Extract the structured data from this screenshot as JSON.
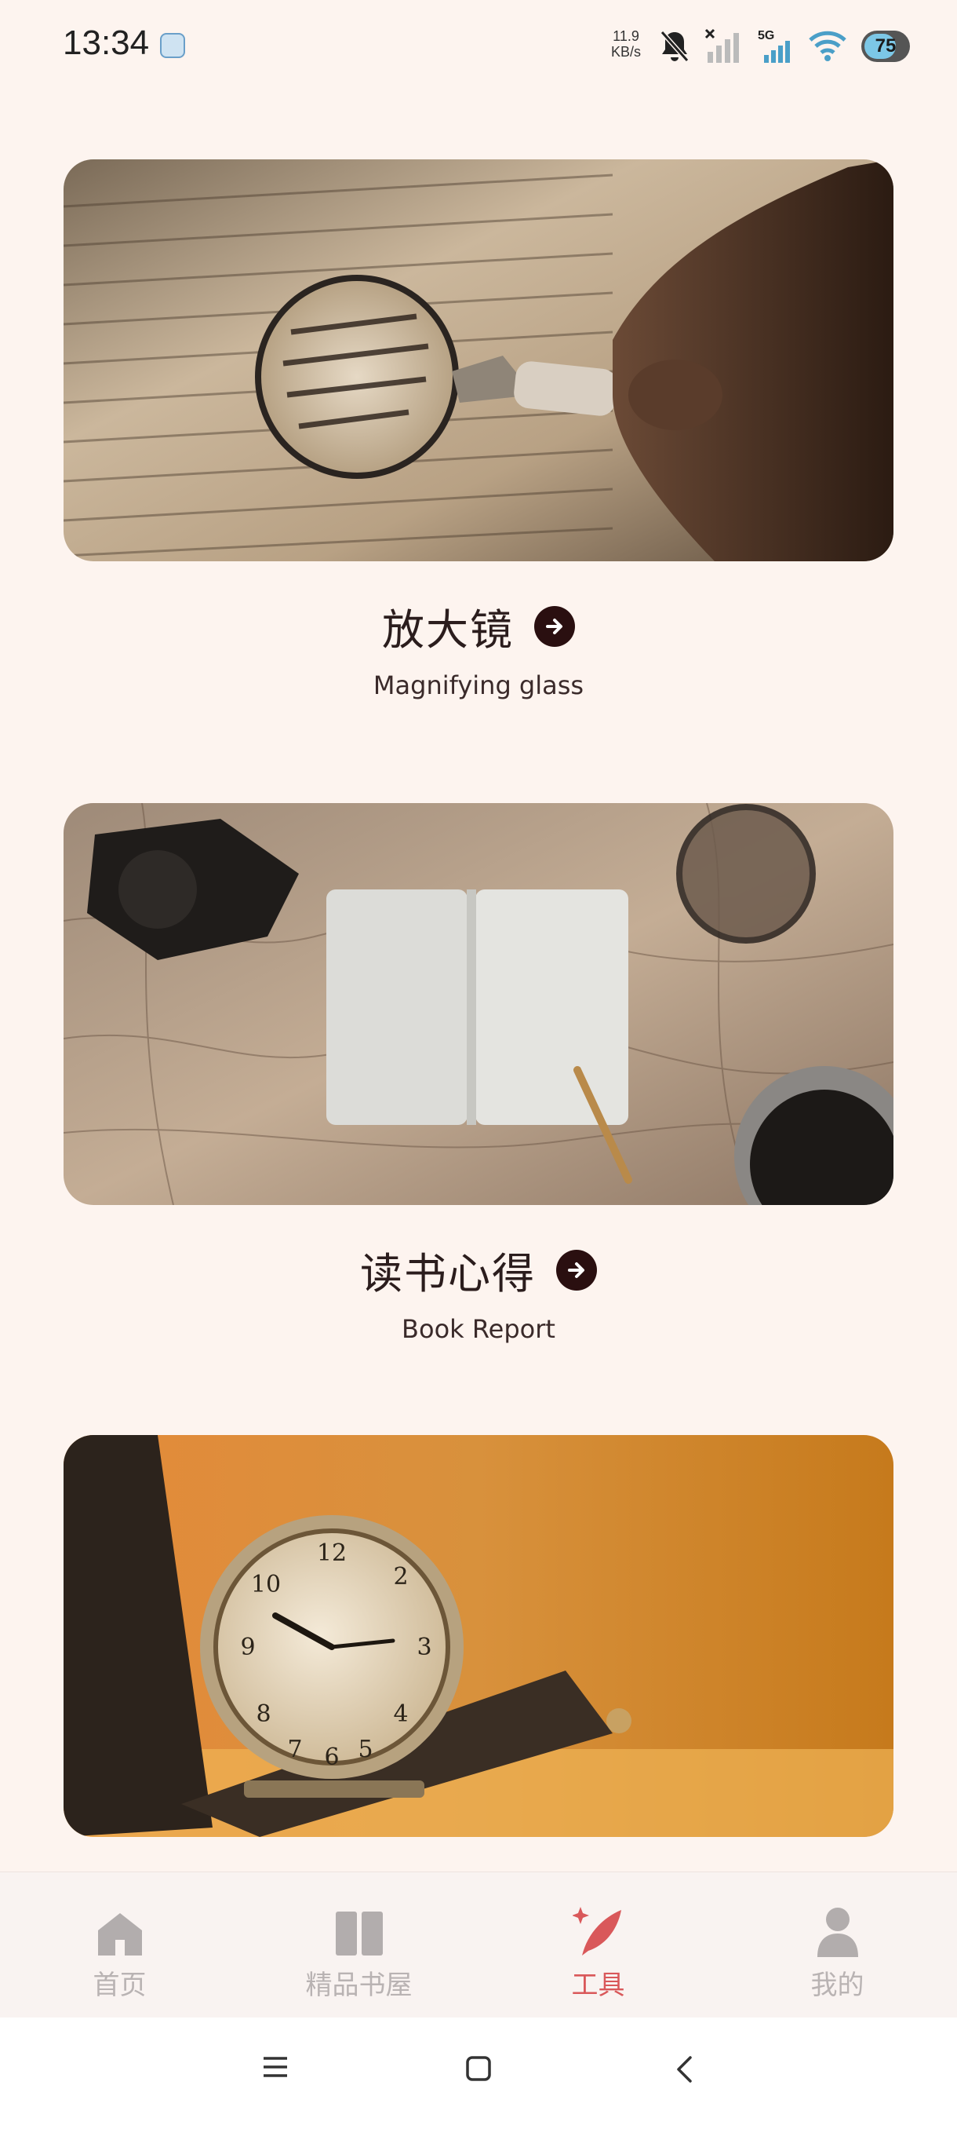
{
  "status_bar": {
    "time": "13:34",
    "speed_value": "11.9",
    "speed_unit": "KB/s",
    "network": "5G",
    "battery": "75",
    "icons": [
      "app-notification-icon",
      "bell-muted-icon",
      "signal-no-sim-icon",
      "signal-5g-icon",
      "wifi-icon",
      "battery-icon"
    ]
  },
  "cards": [
    {
      "title": "放大镜",
      "subtitle": "Magnifying glass",
      "image": "magnifying-glass-photo"
    },
    {
      "title": "读书心得",
      "subtitle": "Book Report",
      "image": "notebook-map-photo"
    },
    {
      "title": "",
      "subtitle": "",
      "image": "alarm-clock-photo"
    }
  ],
  "bottom_nav": {
    "items": [
      {
        "label": "首页",
        "icon": "home-icon"
      },
      {
        "label": "精品书屋",
        "icon": "book-icon"
      },
      {
        "label": "工具",
        "icon": "quill-icon"
      },
      {
        "label": "我的",
        "icon": "person-icon"
      }
    ],
    "active_index": 2
  },
  "colors": {
    "background": "#fdf4ef",
    "accent": "#d9585a",
    "inactive": "#b9b3b3",
    "title_text": "#2b1d1d",
    "arrow_button": "#2a0f10"
  }
}
